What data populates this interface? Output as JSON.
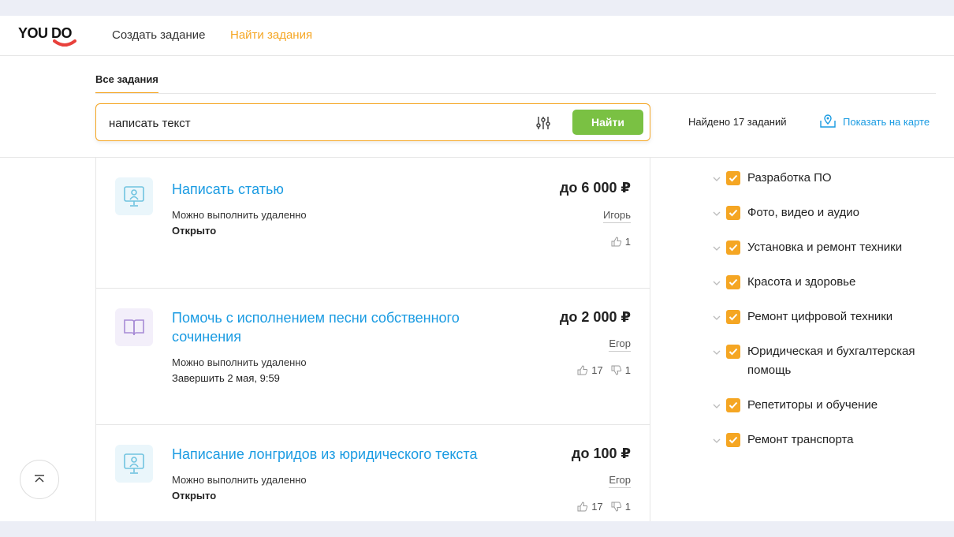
{
  "header": {
    "logo_text": "YOU DO",
    "nav_create": "Создать задание",
    "nav_find": "Найти задания"
  },
  "colors": {
    "accent": "#f5a623",
    "link": "#1a9be2",
    "button_green": "#7ac143"
  },
  "tabs": {
    "all": "Все задания"
  },
  "search": {
    "value": "написать текст",
    "button_label": "Найти",
    "filter_icon": "sliders-icon"
  },
  "results": {
    "found": "Найдено 17 заданий",
    "map_link": "Показать на карте"
  },
  "tasks": [
    {
      "icon": "monitor-icon",
      "title": "Написать статью",
      "meta": "Можно выполнить удаленно",
      "status": "Открыто",
      "price": "до 6 000 ₽",
      "author": "Игорь",
      "likes": "1",
      "dislikes": ""
    },
    {
      "icon": "book-icon",
      "title": "Помочь с исполнением песни собственного сочинения",
      "meta": "Можно выполнить удаленно",
      "status": "Завершить 2 мая, 9:59",
      "price": "до 2 000 ₽",
      "author": "Егор",
      "likes": "17",
      "dislikes": "1"
    },
    {
      "icon": "monitor-icon",
      "title": "Написание лонгридов из юридического текста",
      "meta": "Можно выполнить удаленно",
      "status": "Открыто",
      "price": "до 100 ₽",
      "author": "Егор",
      "likes": "17",
      "dislikes": "1"
    }
  ],
  "categories": [
    "Разработка ПО",
    "Фото, видео и аудио",
    "Установка и ремонт техники",
    "Красота и здоровье",
    "Ремонт цифровой техники",
    "Юридическая и бухгалтерская помощь",
    "Репетиторы и обучение",
    "Ремонт транспорта"
  ]
}
